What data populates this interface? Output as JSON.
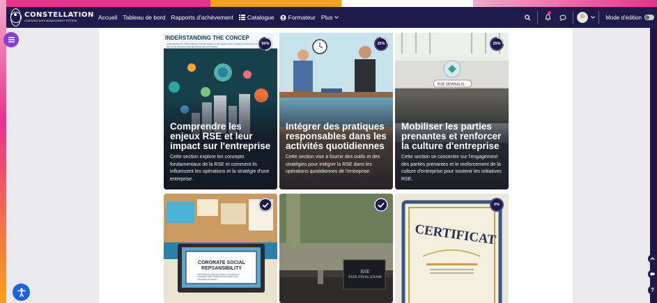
{
  "brand": {
    "name": "CONSTELLATION",
    "subtitle": "LEARNING DATA MANAGEMENT SYSTEM"
  },
  "nav": {
    "links": [
      {
        "label": "Accueil"
      },
      {
        "label": "Tableau de bord"
      },
      {
        "label": "Rapports d'achèvement"
      },
      {
        "label": "Catalogue",
        "icon": "list-icon"
      },
      {
        "label": "Formateur",
        "icon": "user-circle-icon"
      },
      {
        "label": "Plus",
        "icon": "chevron-down-icon"
      }
    ],
    "edit_mode_label": "Mode d'édition"
  },
  "cards": [
    {
      "image_text": "INDERSTANDING THE CONCEP",
      "image_subtext": "understanding the CSR challenges and the impact on the support of the company environment, etc we can incude opeupouncess apposesse aid commancing",
      "progress_label": "50%",
      "progress": 50,
      "title": "Comprendre les enjeux RSE et leur impact sur l'entreprise",
      "description": "Cette section explore les concepts fondamentaux de la RSE et comment ils influencent les opérations et la stratégie d'une entreprise."
    },
    {
      "progress_label": "25%",
      "progress": 25,
      "title": "Intégrer des pratiques responsables dans les activités quotidiennes",
      "description": "Cette section vise à fournir des outils et des stratégies pour intégrer la RSE dans les opérations quotidiennes de l'entreprise."
    },
    {
      "image_text": "RSE SEMINALIS",
      "progress_label": "25%",
      "progress": 25,
      "title": "Mobiliser les parties prenantes et renforcer la culture d'entreprise",
      "description": "Cette section se concentre sur l'engagement des parties prenantes et le renforcement de la culture d'entreprise pour soutenir les initiatives RSE."
    },
    {
      "image_text": "CORORATE SOCIAL REPSANSIBILITY",
      "image_subtext": "CSR is business today is key thing to innovation and sustainable market. Today's plan and shlose hoe & connectivity and support.",
      "progress": 100,
      "completed": true
    },
    {
      "image_text": "RSE",
      "image_subtext": "FSSE FINAL EXAM",
      "progress": 100,
      "completed": true
    },
    {
      "image_text": "CERTIFICAT",
      "progress_label": "0%",
      "progress": 0
    }
  ],
  "colors": {
    "navbar": "#1f1a4b",
    "accent_pink": "#e8328a",
    "accent_orange": "#f7a21b",
    "drawer": "#8a3fd0",
    "a11y": "#1f63d6"
  }
}
